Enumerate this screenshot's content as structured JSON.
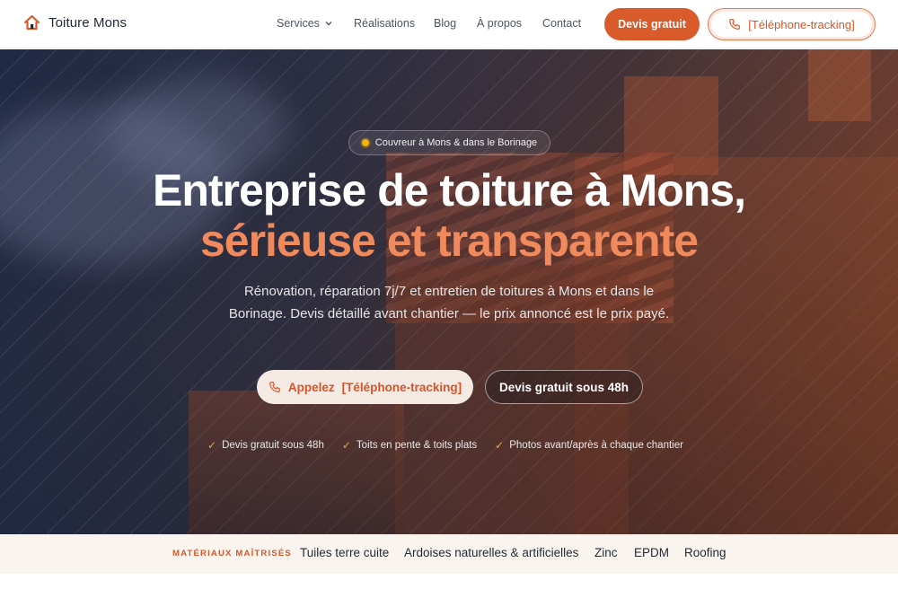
{
  "nav": {
    "brand": "Toiture Mons",
    "menu": {
      "services": "Services",
      "realisations": "Réalisations",
      "blog": "Blog",
      "apropos": "À propos",
      "contact": "Contact"
    },
    "cta_devis": "Devis gratuit",
    "cta_phone": "[Téléphone-tracking]"
  },
  "hero": {
    "badge": "Couvreur à Mons & dans le Borinage",
    "title_line1": "Entreprise de toiture à Mons,",
    "title_line2": "sérieuse et transparente",
    "lead": "Rénovation, réparation 7j/7 et entretien de toitures à Mons et dans le Borinage. Devis détaillé avant chantier — le prix annoncé est le prix payé.",
    "btn_call_prefix": "Appelez",
    "btn_call_phone": "[Téléphone-tracking]",
    "btn_devis": "Devis gratuit sous 48h",
    "checks": [
      "Devis gratuit sous 48h",
      "Toits en pente & toits plats",
      "Photos avant/après à chaque chantier"
    ]
  },
  "materials": {
    "label": "MATÉRIAUX MAÎTRISÉS",
    "items": [
      "Tuiles terre cuite",
      "Ardoises naturelles & artificielles",
      "Zinc",
      "EPDM",
      "Roofing"
    ]
  },
  "colors": {
    "accent": "#d95a2a",
    "accent_light": "#f08a5d",
    "check": "#e8a547"
  }
}
